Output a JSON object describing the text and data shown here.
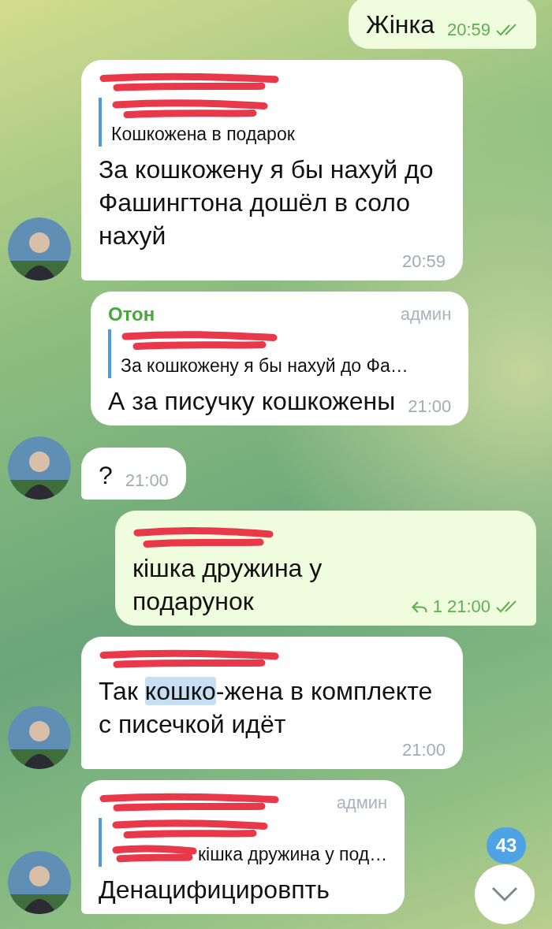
{
  "messages": [
    {
      "kind": "outgoing",
      "text": "Жінка",
      "time": "20:59",
      "read": true
    },
    {
      "kind": "incoming",
      "avatar": true,
      "sender_redacted": true,
      "reply": {
        "author_redacted": true,
        "text": "Кошкожена в подарок"
      },
      "text": "За кошкожену я бы нахуй до Фашингтона дошёл в соло нахуй",
      "time": "20:59"
    },
    {
      "kind": "incoming",
      "sender": "Отон",
      "role": "админ",
      "reply": {
        "author_redacted": true,
        "text": "За кошкожену я бы нахуй до Фа…"
      },
      "text": "А за писучку кошкожены",
      "time": "21:00"
    },
    {
      "kind": "incoming",
      "avatar": true,
      "text": "?",
      "time": "21:00"
    },
    {
      "kind": "outgoing",
      "mention_redacted": true,
      "text": "кішка дружина у подарунок",
      "replies": "1",
      "time": "21:00",
      "read": true
    },
    {
      "kind": "incoming",
      "avatar": true,
      "sender_redacted": true,
      "parts": [
        {
          "text": "Так ",
          "selected": false
        },
        {
          "text": "кошко",
          "selected": true
        },
        {
          "text": "-жена в комплекте с писечкой идёт",
          "selected": false
        }
      ],
      "time": "21:00"
    },
    {
      "kind": "incoming",
      "avatar": true,
      "sender_redacted": true,
      "role": "админ",
      "reply": {
        "author_redacted": true,
        "mention_redacted": true,
        "text": "кішка дружина у под…"
      },
      "text": "Денацифицировпть"
    }
  ],
  "scroll_button": {
    "badge": "43"
  }
}
